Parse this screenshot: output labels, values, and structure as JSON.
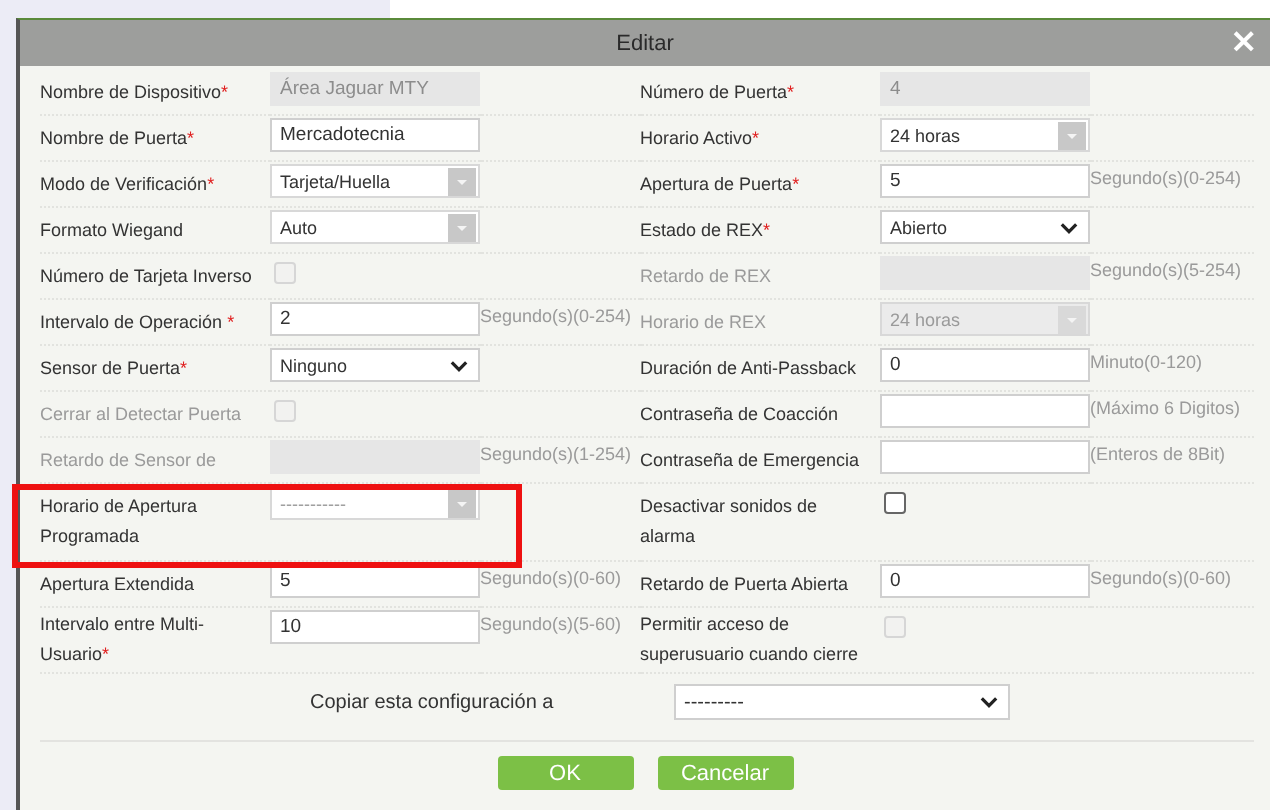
{
  "window": {
    "title": "Editar",
    "close": "×"
  },
  "rows": [
    {
      "left": {
        "label": "Nombre de Dispositivo",
        "mark": "*",
        "disabled": false,
        "field": {
          "kind": "input",
          "value": "Área Jaguar MTY",
          "disabled": true
        }
      },
      "right": {
        "label": "Número de Puerta",
        "mark": "*",
        "disabled": false,
        "field": {
          "kind": "input",
          "value": "4",
          "disabled": true
        }
      }
    },
    {
      "left": {
        "label": "Nombre de Puerta",
        "mark": "*",
        "disabled": false,
        "field": {
          "kind": "input",
          "value": "Mercadotecnia",
          "disabled": false
        }
      },
      "right": {
        "label": "Horario Activo",
        "mark": "*",
        "disabled": false,
        "field": {
          "kind": "combo",
          "value": "24 horas",
          "disabled": false
        }
      }
    },
    {
      "left": {
        "label": "Modo de Verificación",
        "mark": "*",
        "disabled": false,
        "field": {
          "kind": "combo",
          "value": "Tarjeta/Huella",
          "disabled": false
        }
      },
      "right": {
        "label": "Apertura de Puerta",
        "mark": "*",
        "disabled": false,
        "field": {
          "kind": "input",
          "value": "5",
          "disabled": false
        },
        "hint": "Segundo(s)(0-254)"
      }
    },
    {
      "left": {
        "label": "Formato Wiegand",
        "disabled": false,
        "field": {
          "kind": "combo",
          "value": "Auto",
          "disabled": false
        }
      },
      "right": {
        "label": "Estado de REX",
        "mark": "*",
        "disabled": false,
        "field": {
          "kind": "select",
          "value": "Abierto"
        }
      }
    },
    {
      "left": {
        "label": "Número de Tarjeta Inverso",
        "disabled": false,
        "field": {
          "kind": "checkbox",
          "checked": false,
          "disabled": true
        }
      },
      "right": {
        "label": "Retardo de REX",
        "disabled": true,
        "field": {
          "kind": "input",
          "disabled": true
        },
        "hint": "Segundo(s)(5-254)"
      }
    },
    {
      "left": {
        "label": "Intervalo de Operación ",
        "mark": "*",
        "disabled": false,
        "field": {
          "kind": "input",
          "value": "2",
          "disabled": false
        },
        "hint": "Segundo(s)(0-254)"
      },
      "right": {
        "label": "Horario de REX",
        "disabled": true,
        "field": {
          "kind": "combo",
          "value": "24 horas",
          "disabled": true
        }
      }
    },
    {
      "left": {
        "label": "Sensor de Puerta",
        "mark": "*",
        "disabled": false,
        "field": {
          "kind": "select",
          "value": "Ninguno"
        }
      },
      "right": {
        "label": "Duración de Anti-Passback",
        "disabled": false,
        "field": {
          "kind": "input",
          "value": "0",
          "disabled": false
        },
        "hint": "Minuto(0-120)"
      }
    },
    {
      "left": {
        "label": "Cerrar al Detectar Puerta",
        "disabled": true,
        "field": {
          "kind": "checkbox",
          "checked": false,
          "disabled": true
        }
      },
      "right": {
        "label": "Contraseña de Coacción",
        "disabled": false,
        "field": {
          "kind": "input",
          "disabled": false
        },
        "hint": "(Máximo 6 Digitos)"
      }
    },
    {
      "left": {
        "label": "Retardo de Sensor de",
        "disabled": true,
        "field": {
          "kind": "input",
          "disabled": true
        },
        "hint": "Segundo(s)(1-254)"
      },
      "right": {
        "label": "Contraseña de Emergencia",
        "disabled": false,
        "field": {
          "kind": "input",
          "disabled": false
        },
        "hint": "(Enteros de 8Bit)"
      }
    },
    {
      "left": {
        "label": "Horario de Apertura Programada",
        "disabled": false,
        "highlighted": true,
        "field": {
          "kind": "combo",
          "value": "-----------",
          "disabled": false
        }
      },
      "right": {
        "label": "Desactivar sonidos de alarma",
        "disabled": false,
        "field": {
          "kind": "checkbox",
          "checked": false,
          "disabled": false
        }
      }
    },
    {
      "left": {
        "label": "Apertura Extendida",
        "disabled": false,
        "field": {
          "kind": "input",
          "value": "5",
          "disabled": false
        },
        "hint": "Segundo(s)(0-60)"
      },
      "right": {
        "label": "Retardo de Puerta Abierta",
        "disabled": false,
        "field": {
          "kind": "input",
          "value": "0",
          "disabled": false
        },
        "hint": "Segundo(s)(0-60)"
      }
    },
    {
      "left": {
        "label": "Intervalo entre Multi-Usuario",
        "mark": "*",
        "disabled": false,
        "field": {
          "kind": "input",
          "value": "10",
          "disabled": false
        },
        "hint": "Segundo(s)(5-60)"
      },
      "right": {
        "label": "Permitir acceso de superusuario cuando cierre",
        "disabled": false,
        "field": {
          "kind": "checkbox",
          "checked": false,
          "disabled": true
        }
      }
    }
  ],
  "copy": {
    "label": "Copiar esta configuración a",
    "value": "---------"
  },
  "buttons": [
    "OK",
    "Cancelar"
  ]
}
